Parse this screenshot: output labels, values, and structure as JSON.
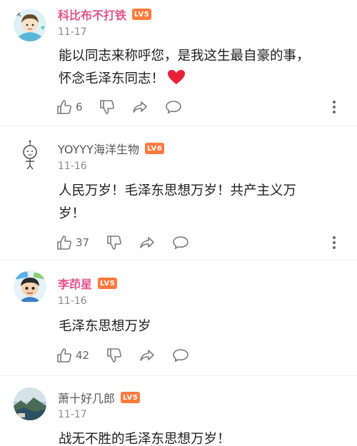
{
  "comments": [
    {
      "username": "科比布不打铁",
      "level": "LV5",
      "date": "11-17",
      "line1": "能以同志来称呼您，是我这生最自豪的事，",
      "line2": "怀念毛泽东同志！",
      "heart_icon": "red-heart-emoji",
      "like_count": "6",
      "name_color": "#e2548a",
      "avatar_icon": "cartoon-boy-avatar"
    },
    {
      "username": "YOYYY海洋生物",
      "level": "LV6",
      "date": "11-16",
      "line1": "人民万岁！毛泽东思想万岁！共产主义万",
      "line2": "岁！",
      "like_count": "37",
      "name_color": "#555555",
      "avatar_icon": "stick-figure-avatar"
    },
    {
      "username": "李茚星",
      "level": "LV5",
      "date": "11-16",
      "line1": "毛泽东思想万岁",
      "like_count": "42",
      "name_color": "#e2548a",
      "avatar_icon": "cartoon-character-avatar"
    },
    {
      "username": "萧十好几郎",
      "level": "LV5",
      "date": "11-17",
      "line1": "战无不胜的毛泽东思想万岁！",
      "name_color": "#555555",
      "avatar_icon": "landscape-photo-avatar"
    }
  ],
  "colors": {
    "badge": "#ff7a3c",
    "heart": "#e8213b",
    "icon": "#7a7a7a"
  },
  "icons": [
    "thumbs-up-icon",
    "thumbs-down-icon",
    "share-icon",
    "comment-icon",
    "more-icon"
  ]
}
